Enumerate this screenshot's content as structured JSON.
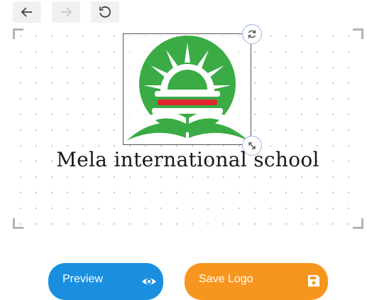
{
  "toolbar": {
    "icons": [
      "arrow-left-icon",
      "arrow-right-icon",
      "rotate-reset-icon"
    ],
    "redo_disabled": true
  },
  "canvas": {
    "school_name": "Mela international school",
    "logo": {
      "colors": {
        "green": "#3bab45",
        "red": "#e0262d"
      }
    },
    "handles": [
      "rotate-icon",
      "resize-icon"
    ]
  },
  "actions": {
    "preview_label": "Preview",
    "preview_icon": "eye-icon",
    "preview_color": "#1a8fe0",
    "save_label": "Save Logo",
    "save_icon": "floppy-disk-icon",
    "save_color": "#f7961f"
  }
}
